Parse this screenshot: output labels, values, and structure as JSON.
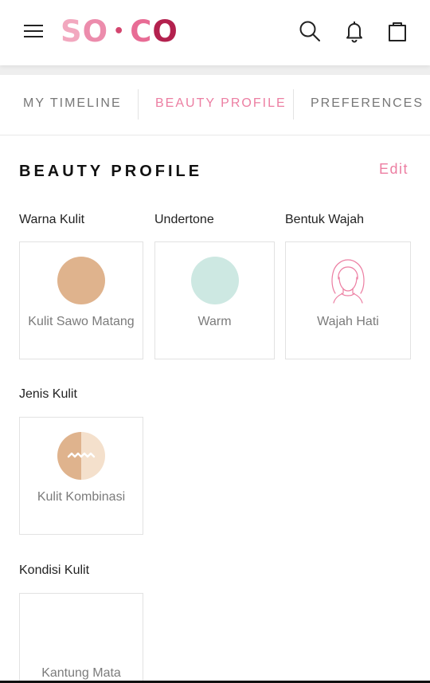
{
  "app": {
    "name": "SOCO"
  },
  "header": {
    "logo": {
      "part1": "S",
      "part2": "O",
      "dot": "•",
      "part3": "C",
      "part4": "O"
    },
    "icons": [
      "menu-icon",
      "search-icon",
      "bell-icon",
      "shopping-bag-icon"
    ]
  },
  "tabs": [
    {
      "label": "MY TIMELINE",
      "active": false
    },
    {
      "label": "BEAUTY PROFILE",
      "active": true
    },
    {
      "label": "PREFERENCES",
      "active": false
    }
  ],
  "section": {
    "title": "BEAUTY PROFILE",
    "edit_label": "Edit"
  },
  "profile": {
    "skin_color": {
      "label": "Warna Kulit",
      "value": "Kulit Sawo Matang",
      "swatch": "#dfb38d"
    },
    "undertone": {
      "label": "Undertone",
      "value": "Warm",
      "swatch": "#cde8e2"
    },
    "face_shape": {
      "label": "Bentuk Wajah",
      "value": "Wajah Hati",
      "icon": "face-outline-icon"
    },
    "skin_type": {
      "label": "Jenis Kulit",
      "value": "Kulit Kombinasi",
      "icon": "combination-skin-icon"
    },
    "skin_condition": {
      "label": "Kondisi Kulit",
      "value": "Kantung Mata"
    }
  },
  "colors": {
    "accent": "#ec7ea2",
    "brand_dark": "#b3214e",
    "text": "#222222",
    "muted": "#7b7b7b",
    "border": "#e2e2e2"
  }
}
